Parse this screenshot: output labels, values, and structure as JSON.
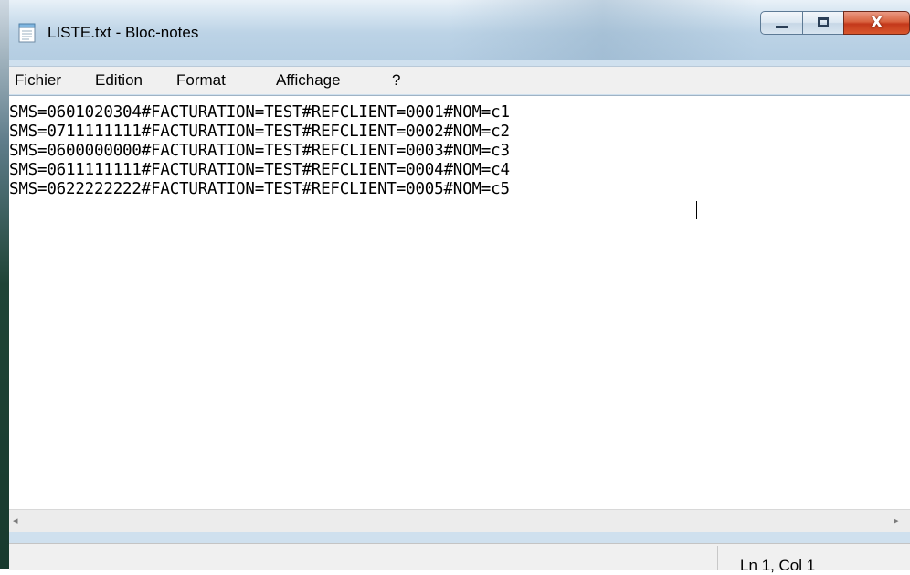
{
  "window": {
    "title": "LISTE.txt - Bloc-notes",
    "app_icon": "notepad-icon",
    "controls": {
      "minimize": "minimize-icon",
      "maximize": "maximize-icon",
      "close_glyph": "X"
    }
  },
  "menubar": {
    "items": [
      {
        "label": "Fichier"
      },
      {
        "label": "Edition"
      },
      {
        "label": "Format"
      },
      {
        "label": "Affichage"
      },
      {
        "label": "?"
      }
    ]
  },
  "editor": {
    "lines": [
      "SMS=0601020304#FACTURATION=TEST#REFCLIENT=0001#NOM=c1",
      "SMS=0711111111#FACTURATION=TEST#REFCLIENT=0002#NOM=c2",
      "SMS=0600000000#FACTURATION=TEST#REFCLIENT=0003#NOM=c3",
      "SMS=0611111111#FACTURATION=TEST#REFCLIENT=0004#NOM=c4",
      "SMS=0622222222#FACTURATION=TEST#REFCLIENT=0005#NOM=c5"
    ]
  },
  "scrollbar": {
    "left_arrow": "◂",
    "right_arrow": "▸"
  },
  "statusbar": {
    "position": "Ln 1, Col 1"
  },
  "colors": {
    "close_button": "#c4391b",
    "titlebar": "#bcd3e6",
    "menubar": "#f0f0f0"
  }
}
